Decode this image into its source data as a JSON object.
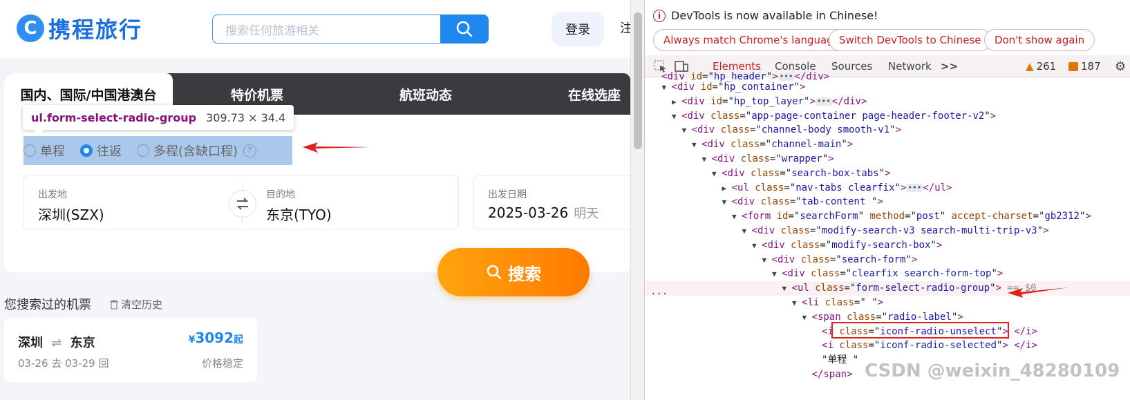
{
  "site": {
    "logo_text": "携程旅行",
    "search_placeholder": "搜索任何旅游相关",
    "login": "登录",
    "register": "注"
  },
  "tabs": [
    "国内、国际/中国港澳台",
    "特价机票",
    "航班动态",
    "在线选座"
  ],
  "tooltip": {
    "selector": "ul.form-select-radio-group",
    "size": "309.73 × 34.4"
  },
  "trip_types": [
    {
      "label": "单程",
      "selected": false
    },
    {
      "label": "往返",
      "selected": true
    },
    {
      "label": "多程(含缺口程)",
      "selected": false
    }
  ],
  "help_glyph": "?",
  "form": {
    "from_label": "出发地",
    "from_value": "深圳(SZX)",
    "to_label": "目的地",
    "to_value": "东京(TYO)",
    "date_label": "出发日期",
    "date_value": "2025-03-26",
    "date_sub": "明天"
  },
  "search_button": "搜索",
  "history": {
    "title": "您搜索过的机票",
    "clear": "清空历史",
    "route_from": "深圳",
    "route_to": "东京",
    "dates": "03-26 去   03-29 回",
    "currency": "¥",
    "price": "3092",
    "price_suffix": "起",
    "stability": "价格稳定"
  },
  "devtools": {
    "notice": "DevTools is now available in Chinese!",
    "btn_match": "Always match Chrome's language",
    "btn_switch": "Switch DevTools to Chinese",
    "btn_dismiss": "Don't show again",
    "tabs": [
      "Elements",
      "Console",
      "Sources",
      "Network"
    ],
    "more": ">>",
    "warnings": "261",
    "errors": "187",
    "selected_dots": "..."
  },
  "dom_tree": [
    {
      "indent": 0,
      "tri": "",
      "tag": "div",
      "attrs": [
        [
          "id",
          "hp_header"
        ]
      ],
      "tail": "…</div>",
      "partial": true
    },
    {
      "indent": 1,
      "tri": "▼",
      "tag": "div",
      "attrs": [
        [
          "id",
          "hp_container"
        ]
      ],
      "tail": ""
    },
    {
      "indent": 2,
      "tri": "▶",
      "tag": "div",
      "attrs": [
        [
          "id",
          "hp_top_layer"
        ]
      ],
      "tail": "ELL</div>"
    },
    {
      "indent": 2,
      "tri": "▼",
      "tag": "div",
      "attrs": [
        [
          "class",
          "app-page-container page-header-footer-v2"
        ]
      ],
      "tail": ""
    },
    {
      "indent": 3,
      "tri": "▼",
      "tag": "div",
      "attrs": [
        [
          "class",
          "channel-body smooth-v1"
        ]
      ],
      "tail": ""
    },
    {
      "indent": 4,
      "tri": "▼",
      "tag": "div",
      "attrs": [
        [
          "class",
          "channel-main"
        ]
      ],
      "tail": ""
    },
    {
      "indent": 5,
      "tri": "▼",
      "tag": "div",
      "attrs": [
        [
          "class",
          "wrapper"
        ]
      ],
      "tail": ""
    },
    {
      "indent": 6,
      "tri": "▼",
      "tag": "div",
      "attrs": [
        [
          "class",
          "search-box-tabs"
        ]
      ],
      "tail": ""
    },
    {
      "indent": 7,
      "tri": "▶",
      "tag": "ul",
      "attrs": [
        [
          "class",
          "nav-tabs clearfix"
        ]
      ],
      "tail": "ELL</ul>"
    },
    {
      "indent": 7,
      "tri": "▼",
      "tag": "div",
      "attrs": [
        [
          "class",
          "tab-content "
        ]
      ],
      "tail": ""
    },
    {
      "indent": 8,
      "tri": "▼",
      "tag": "form",
      "attrs": [
        [
          "id",
          "searchForm"
        ],
        [
          "method",
          "post"
        ],
        [
          "accept-charset",
          "gb2312"
        ]
      ],
      "tail": ""
    },
    {
      "indent": 9,
      "tri": "▼",
      "tag": "div",
      "attrs": [
        [
          "class",
          "modify-search-v3 search-multi-trip-v3"
        ]
      ],
      "tail": ""
    },
    {
      "indent": 10,
      "tri": "▼",
      "tag": "div",
      "attrs": [
        [
          "class",
          "modify-search-box"
        ]
      ],
      "tail": ""
    },
    {
      "indent": 11,
      "tri": "▼",
      "tag": "div",
      "attrs": [
        [
          "class",
          "search-form"
        ]
      ],
      "tail": ""
    },
    {
      "indent": 12,
      "tri": "▼",
      "tag": "div",
      "attrs": [
        [
          "class",
          "clearfix search-form-top"
        ]
      ],
      "tail": ""
    },
    {
      "indent": 13,
      "tri": "▼",
      "tag": "ul",
      "attrs": [
        [
          "class",
          "form-select-radio-group"
        ]
      ],
      "tail": " == $0",
      "selected": true
    },
    {
      "indent": 14,
      "tri": "▼",
      "tag": "li",
      "attrs": [
        [
          "class",
          "  "
        ]
      ],
      "tail": ""
    },
    {
      "indent": 15,
      "tri": "▼",
      "tag": "span",
      "attrs": [
        [
          "class",
          "radio-label"
        ]
      ],
      "tail": ""
    },
    {
      "indent": 16,
      "tri": "",
      "tag": "i",
      "attrs": [
        [
          "class",
          "iconf-radio-unselect"
        ]
      ],
      "tail": " </i>"
    },
    {
      "indent": 16,
      "tri": "",
      "tag": "i",
      "attrs": [
        [
          "class",
          "iconf-radio-selected"
        ]
      ],
      "tail": " </i>"
    },
    {
      "indent": 16,
      "tri": "",
      "text": "\"单程 \""
    },
    {
      "indent": 15,
      "tri": "",
      "close": "</span>"
    }
  ],
  "watermark": "CSDN @weixin_48280109",
  "colors": {
    "brand_blue": "#1e87f0",
    "search_orange": "#ff8a00",
    "devtools_red": "#c5221f",
    "highlight": "#a9c8ec"
  }
}
